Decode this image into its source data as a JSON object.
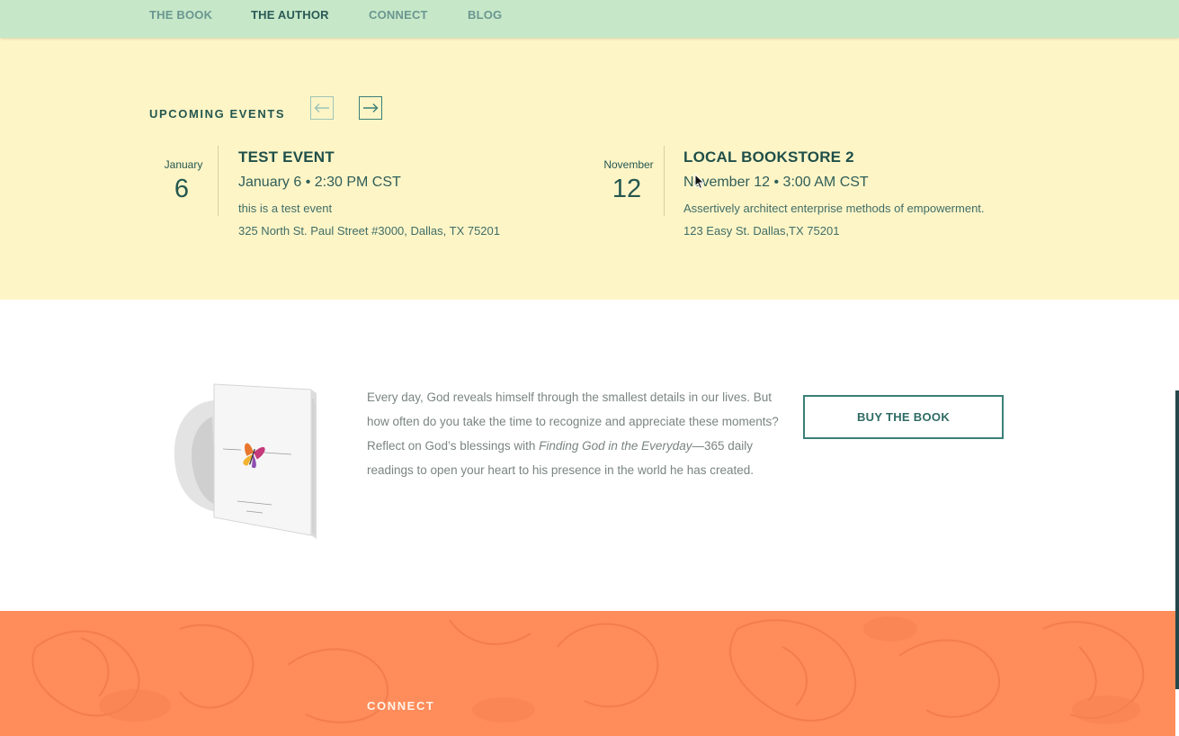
{
  "nav": {
    "items": [
      {
        "label": "THE BOOK",
        "active": false
      },
      {
        "label": "THE AUTHOR",
        "active": true
      },
      {
        "label": "CONNECT",
        "active": false
      },
      {
        "label": "BLOG",
        "active": false
      }
    ]
  },
  "events": {
    "heading": "UPCOMING EVENTS",
    "prev_icon": "arrow-left-icon",
    "next_icon": "arrow-right-icon",
    "items": [
      {
        "month": "January",
        "day": "6",
        "title": "TEST EVENT",
        "datetime": "January 6 • 2:30 PM CST",
        "description": "this is a test event",
        "address": "325 North St. Paul Street #3000, Dallas, TX 75201"
      },
      {
        "month": "November",
        "day": "12",
        "title": "LOCAL BOOKSTORE 2",
        "datetime": "November 12 • 3:00 AM CST",
        "description": "Assertively architect enterprise methods of empowerment.",
        "address": "123 Easy St. Dallas,TX 75201"
      }
    ]
  },
  "book": {
    "text_before": "Every day, God reveals himself through the smallest details in our lives. But how often do you take the time to recognize and appreciate these moments? Reflect on God’s blessings with ",
    "title_italic": "Finding God in the Everyday",
    "text_after": "—365 daily readings to open your heart to his presence in the world he has created.",
    "buy_label": "BUY THE BOOK"
  },
  "footer": {
    "connect_heading": "CONNECT"
  },
  "colors": {
    "nav_bg": "#c6e8c8",
    "events_bg": "#fef5c7",
    "footer_bg": "#ff8c5b",
    "accent": "#3b7f77"
  }
}
